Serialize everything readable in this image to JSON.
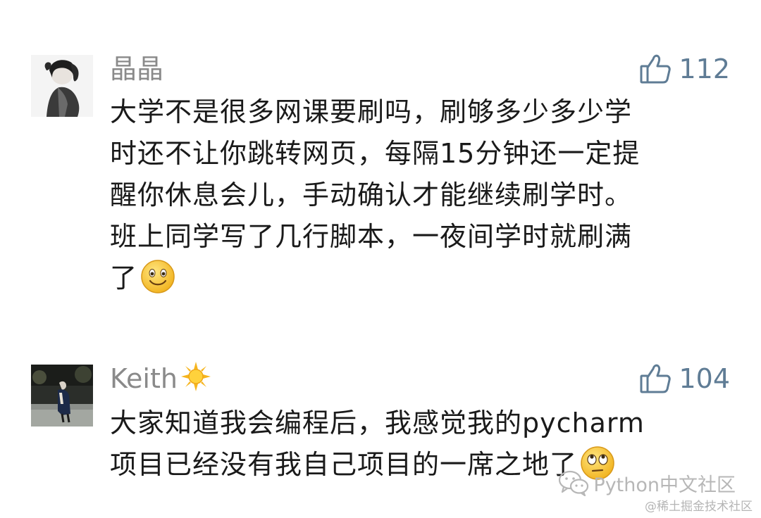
{
  "comments": [
    {
      "author": "晶晶",
      "likes": "112",
      "content_lines": [
        "大学不是很多网课要刷吗，刷够多少多少学",
        "时还不让你跳转网页，每隔15分钟还一定提",
        "醒你休息会儿，手动确认才能继续刷学时。",
        "班上同学写了几行脚本，一夜间学时就刷满",
        "了"
      ],
      "avatar_icon": "user-avatar-photo",
      "like_icon": "thumbs-up-icon",
      "trailing_emoji": "smile-emoji-icon"
    },
    {
      "author": "Keith",
      "author_emoji": "sun-emoji-icon",
      "likes": "104",
      "content_lines": [
        "大家知道我会编程后，我感觉我的pycharm",
        "项目已经没有我自己项目的一席之地了"
      ],
      "avatar_icon": "user-avatar-photo",
      "like_icon": "thumbs-up-icon",
      "trailing_emoji": "eye-roll-emoji-icon"
    }
  ],
  "watermark": {
    "text": "Python中文社区",
    "icon": "wechat-icon"
  },
  "footer": {
    "text": "@稀土掘金技术社区"
  },
  "colors": {
    "author": "#8a8a8a",
    "likes": "#5f7c95",
    "content": "#1a1a1a",
    "watermark": "#b7b7b7"
  }
}
